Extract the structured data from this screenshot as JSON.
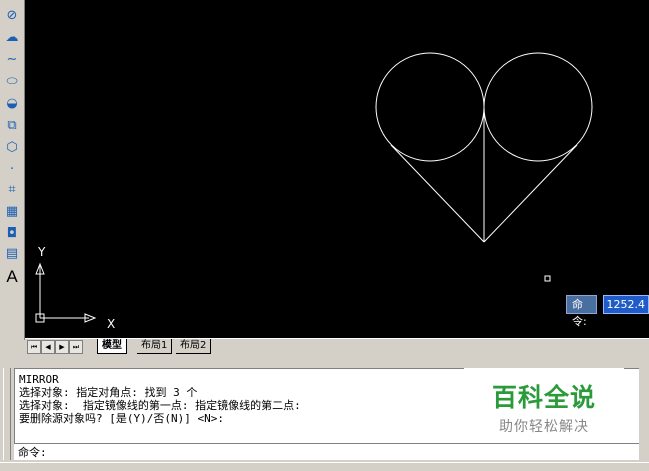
{
  "toolbar": {
    "tools": [
      {
        "name": "circle-icon",
        "glyph": "⊘"
      },
      {
        "name": "revcloud-icon",
        "glyph": "☁"
      },
      {
        "name": "spline-icon",
        "glyph": "∼"
      },
      {
        "name": "ellipse-icon",
        "glyph": "⬭"
      },
      {
        "name": "ellipse-arc-icon",
        "glyph": "◒"
      },
      {
        "name": "insert-block-icon",
        "glyph": "⧉"
      },
      {
        "name": "make-block-icon",
        "glyph": "⬡"
      },
      {
        "name": "point-icon",
        "glyph": "·"
      },
      {
        "name": "hatch-icon",
        "glyph": "⌗"
      },
      {
        "name": "gradient-icon",
        "glyph": "▦"
      },
      {
        "name": "region-icon",
        "glyph": "◘"
      },
      {
        "name": "table-icon",
        "glyph": "▤"
      },
      {
        "name": "multiline-text-icon",
        "glyph": "A"
      }
    ]
  },
  "viewport": {
    "ucs_y_label": "Y",
    "ucs_x_label": "X",
    "tooltip_label": "命令:",
    "tooltip_value": "1252.4"
  },
  "layout_tabs": {
    "tabs": [
      "模型",
      "布局1",
      "布局2"
    ],
    "nav_buttons": [
      "first",
      "prev",
      "next",
      "last"
    ]
  },
  "command_window": {
    "history": [
      "MIRROR",
      "选择对象: 指定对角点: 找到 3 个",
      "选择对象:  指定镜像线的第一点: 指定镜像线的第二点:",
      "要删除源对象吗? [是(Y)/否(N)] <N>:"
    ],
    "prompt": "命令:"
  },
  "watermark": {
    "title": "百科全说",
    "subtitle": "助你轻松解决"
  },
  "colors": {
    "viewport_bg": "#000000",
    "drawing_stroke": "#ffffff",
    "watermark_green": "#2a9a3a"
  }
}
